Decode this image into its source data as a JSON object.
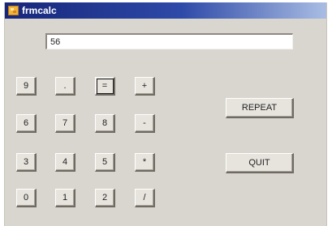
{
  "window": {
    "title": "frmcalc",
    "app_icon": "form-icon"
  },
  "display": {
    "value": "56"
  },
  "keypad": {
    "row1": [
      "9",
      ".",
      "=",
      "+"
    ],
    "row2": [
      "6",
      "7",
      "8",
      "-"
    ],
    "row3": [
      "3",
      "4",
      "5",
      "*"
    ],
    "row4": [
      "0",
      "1",
      "2",
      "/"
    ]
  },
  "actions": {
    "repeat_label": "REPEAT",
    "quit_label": "QUIT"
  }
}
